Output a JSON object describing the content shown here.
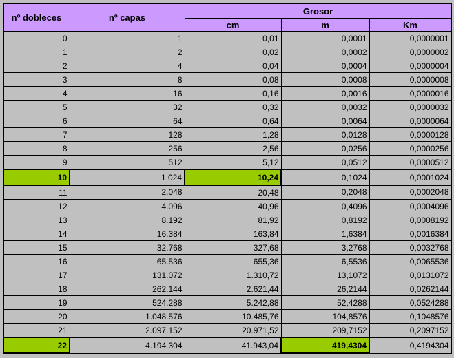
{
  "header": {
    "dobleces": "nº dobleces",
    "capas": "nº capas",
    "grosor": "Grosor",
    "cm": "cm",
    "m": "m",
    "km": "Km"
  },
  "rows": [
    {
      "d": "0",
      "c": "1",
      "cm": "0,01",
      "m": "0,0001",
      "km": "0,0000001"
    },
    {
      "d": "1",
      "c": "2",
      "cm": "0,02",
      "m": "0,0002",
      "km": "0,0000002"
    },
    {
      "d": "2",
      "c": "4",
      "cm": "0,04",
      "m": "0,0004",
      "km": "0,0000004"
    },
    {
      "d": "3",
      "c": "8",
      "cm": "0,08",
      "m": "0,0008",
      "km": "0,0000008"
    },
    {
      "d": "4",
      "c": "16",
      "cm": "0,16",
      "m": "0,0016",
      "km": "0,0000016"
    },
    {
      "d": "5",
      "c": "32",
      "cm": "0,32",
      "m": "0,0032",
      "km": "0,0000032"
    },
    {
      "d": "6",
      "c": "64",
      "cm": "0,64",
      "m": "0,0064",
      "km": "0,0000064"
    },
    {
      "d": "7",
      "c": "128",
      "cm": "1,28",
      "m": "0,0128",
      "km": "0,0000128"
    },
    {
      "d": "8",
      "c": "256",
      "cm": "2,56",
      "m": "0,0256",
      "km": "0,0000256"
    },
    {
      "d": "9",
      "c": "512",
      "cm": "5,12",
      "m": "0,0512",
      "km": "0,0000512"
    },
    {
      "d": "10",
      "c": "1.024",
      "cm": "10,24",
      "m": "0,1024",
      "km": "0,0001024"
    },
    {
      "d": "11",
      "c": "2.048",
      "cm": "20,48",
      "m": "0,2048",
      "km": "0,0002048"
    },
    {
      "d": "12",
      "c": "4.096",
      "cm": "40,96",
      "m": "0,4096",
      "km": "0,0004096"
    },
    {
      "d": "13",
      "c": "8.192",
      "cm": "81,92",
      "m": "0,8192",
      "km": "0,0008192"
    },
    {
      "d": "14",
      "c": "16.384",
      "cm": "163,84",
      "m": "1,6384",
      "km": "0,0016384"
    },
    {
      "d": "15",
      "c": "32.768",
      "cm": "327,68",
      "m": "3,2768",
      "km": "0,0032768"
    },
    {
      "d": "16",
      "c": "65.536",
      "cm": "655,36",
      "m": "6,5536",
      "km": "0,0065536"
    },
    {
      "d": "17",
      "c": "131.072",
      "cm": "1.310,72",
      "m": "13,1072",
      "km": "0,0131072"
    },
    {
      "d": "18",
      "c": "262.144",
      "cm": "2.621,44",
      "m": "26,2144",
      "km": "0,0262144"
    },
    {
      "d": "19",
      "c": "524.288",
      "cm": "5.242,88",
      "m": "52,4288",
      "km": "0,0524288"
    },
    {
      "d": "20",
      "c": "1.048.576",
      "cm": "10.485,76",
      "m": "104,8576",
      "km": "0,1048576"
    },
    {
      "d": "21",
      "c": "2.097.152",
      "cm": "20.971,52",
      "m": "209,7152",
      "km": "0,2097152"
    },
    {
      "d": "22",
      "c": "4.194.304",
      "cm": "41.943,04",
      "m": "419,4304",
      "km": "0,4194304"
    }
  ],
  "highlight_color": "#99cc00",
  "header_color": "#cc99ff"
}
